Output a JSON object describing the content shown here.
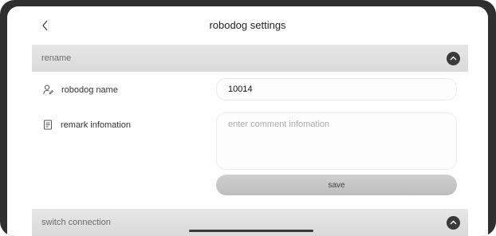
{
  "header": {
    "title": "robodog settings",
    "back_icon": "chevron-left-icon"
  },
  "rename_section": {
    "title": "rename",
    "expanded": true,
    "toggle_icon": "chevron-up-icon",
    "name_label": "robodog name",
    "name_icon": "person-edit-icon",
    "name_value": "10014",
    "remark_label": "remark infomation",
    "remark_icon": "document-icon",
    "remark_placeholder": "enter comment infomation",
    "remark_value": "",
    "save_label": "save"
  },
  "switch_section": {
    "title": "switch connection",
    "toggle_icon": "chevron-up-icon"
  },
  "colors": {
    "section_bar": "#dedede",
    "toggle_button": "#3a3a3a",
    "save_button": "#c6c6c6",
    "device_frame": "#2f2f2f"
  }
}
